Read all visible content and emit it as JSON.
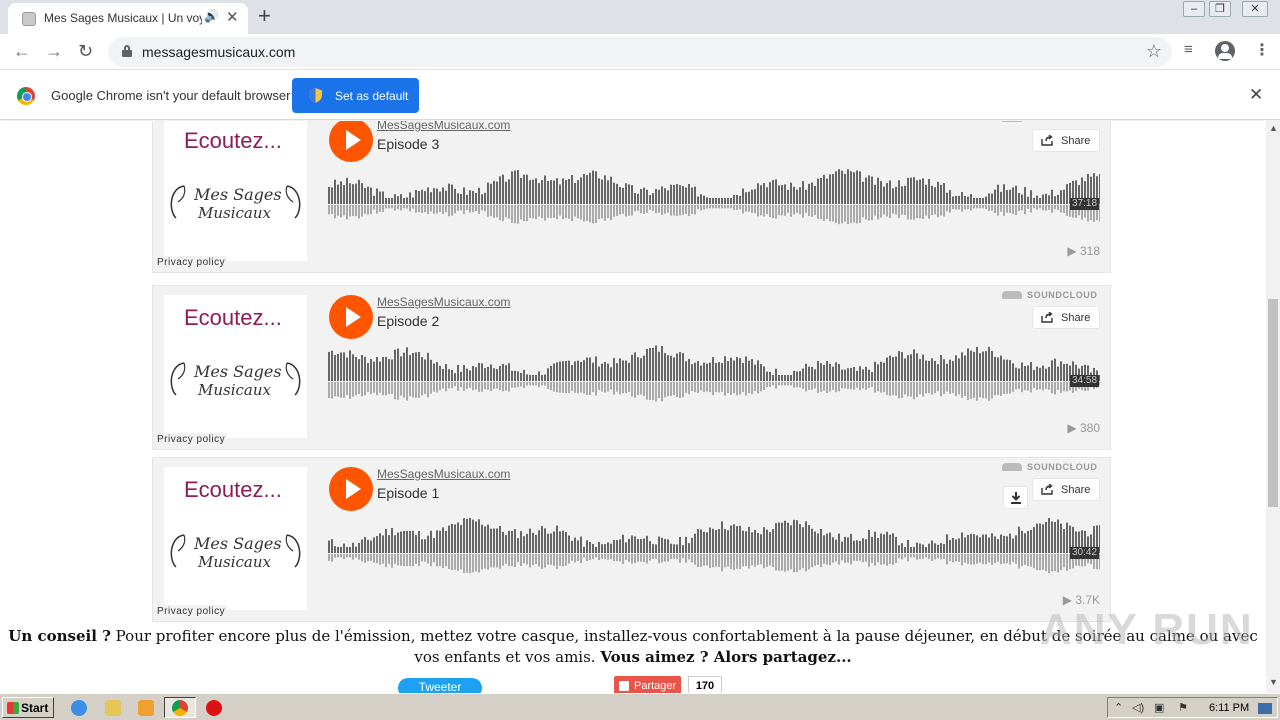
{
  "browser": {
    "tab_title": "Mes Sages Musicaux | Un voyage",
    "tab_audio_glyph": "🔊",
    "tab_close_glyph": "✕",
    "new_tab_glyph": "+",
    "url": "messagesmusicaux.com",
    "back_glyph": "←",
    "forward_glyph": "→",
    "reload_glyph": "↻",
    "star_glyph": "☆",
    "media_glyph": "≡",
    "menu_glyph": "⋮",
    "window_min": "–",
    "window_max": "❐",
    "window_close": "✕"
  },
  "infobar": {
    "message": "Google Chrome isn't your default browser",
    "button_label": "Set as default",
    "close_glyph": "✕"
  },
  "artwork": {
    "line1": "Ecoutez...",
    "line2": "Mes Sages",
    "line3": "Musicaux"
  },
  "players": [
    {
      "uploader": "MesSagesMusicaux.com",
      "title": "Episode 3",
      "duration": "37:18",
      "plays": "318",
      "privacy": "Privacy policy",
      "share": "Share",
      "brand": "SOUNDCLOUD",
      "has_download": false,
      "seed": 3
    },
    {
      "uploader": "MesSagesMusicaux.com",
      "title": "Episode 2",
      "duration": "34:58",
      "plays": "380",
      "privacy": "Privacy policy",
      "share": "Share",
      "brand": "SOUNDCLOUD",
      "has_download": false,
      "seed": 7
    },
    {
      "uploader": "MesSagesMusicaux.com",
      "title": "Episode 1",
      "duration": "30:42",
      "plays": "3.7K",
      "privacy": "Privacy policy",
      "share": "Share",
      "brand": "SOUNDCLOUD",
      "has_download": true,
      "seed": 11
    }
  ],
  "tip": {
    "bold1": "Un conseil ?",
    "text": " Pour profiter encore plus de l'émission, mettez votre casque, installez-vous confortablement à la pause déjeuner, en début de soirée au calme ou avec vos enfants et vos amis. ",
    "bold2": "Vous aimez ? Alors partagez..."
  },
  "social": {
    "tweet": "Tweeter",
    "share": "Partager",
    "count": "170"
  },
  "watermark": "ANY RUN",
  "taskbar": {
    "start": "Start",
    "clock": "6:11 PM"
  },
  "colors": {
    "soundcloud_orange": "#ff5500",
    "chrome_blue": "#1a73e8",
    "waveform_dark": "#666666",
    "waveform_light": "#aaaaaa"
  }
}
